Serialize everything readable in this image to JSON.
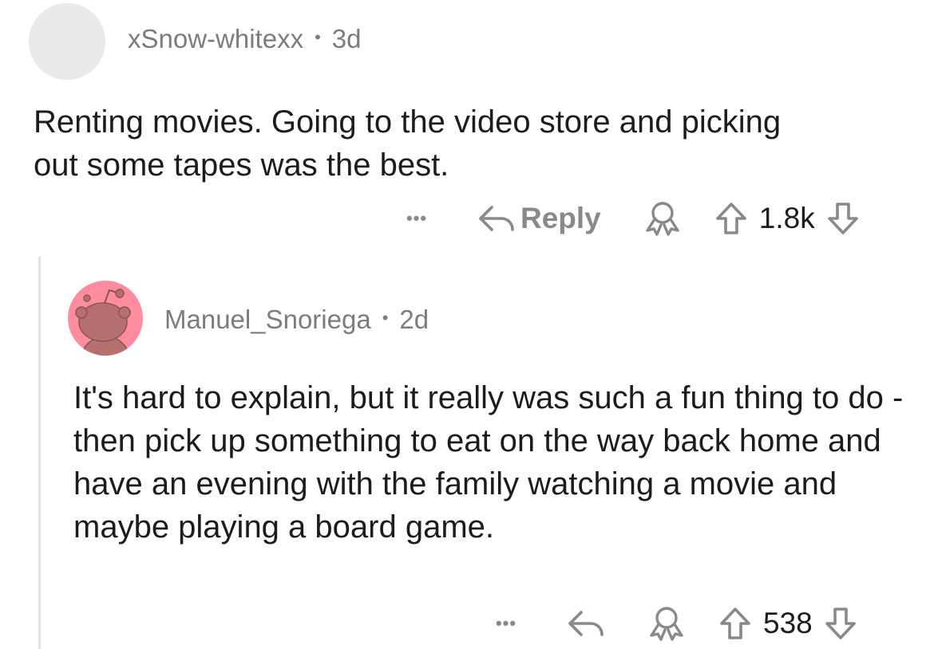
{
  "parent_comment": {
    "author": "xSnow-whitexx",
    "separator": "•",
    "age": "3d",
    "body": "Renting movies. Going to the video store and picking out some tapes was the best.",
    "actions": {
      "more_label": "•••",
      "reply_label": "Reply",
      "score": "1.8k"
    }
  },
  "reply_comment": {
    "author": "Manuel_Snoriega",
    "separator": "•",
    "age": "2d",
    "body": "It's hard to explain, but it really was such a fun thing to do - then pick up something to eat on the way back home and have an evening with the family watching a movie and maybe playing a board game.",
    "actions": {
      "more_label": "•••",
      "score": "538"
    }
  },
  "colors": {
    "text": "#1c1c1c",
    "meta": "#7c7c7c",
    "icon": "#878a8c",
    "thread_line": "#e3e3e3",
    "avatar_pink": "#ff8b9f",
    "avatar_placeholder": "#e9e9eb"
  },
  "icons": [
    "reply-arrow-icon",
    "award-icon",
    "upvote-arrow-icon",
    "downvote-arrow-icon",
    "more-options-icon",
    "snoo-avatar-icon"
  ]
}
